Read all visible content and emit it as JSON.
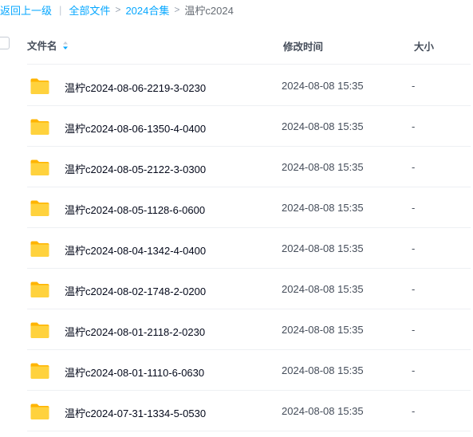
{
  "breadcrumb": {
    "back": "返回上一级",
    "separator": "|",
    "items": [
      "全部文件",
      "2024合集"
    ],
    "current": "温柠c2024"
  },
  "header": {
    "name": "文件名",
    "mtime": "修改时间",
    "size": "大小"
  },
  "colors": {
    "link": "#06a7ff",
    "folder": "#ffc520",
    "sort_active": "#06a7ff"
  },
  "files": [
    {
      "name": "温柠c2024-08-06-2219-3-0230",
      "mtime": "2024-08-08 15:35",
      "size": "-",
      "icon": "folder-icon"
    },
    {
      "name": "温柠c2024-08-06-1350-4-0400",
      "mtime": "2024-08-08 15:35",
      "size": "-",
      "icon": "folder-icon"
    },
    {
      "name": "温柠c2024-08-05-2122-3-0300",
      "mtime": "2024-08-08 15:35",
      "size": "-",
      "icon": "folder-icon"
    },
    {
      "name": "温柠c2024-08-05-1128-6-0600",
      "mtime": "2024-08-08 15:35",
      "size": "-",
      "icon": "folder-icon"
    },
    {
      "name": "温柠c2024-08-04-1342-4-0400",
      "mtime": "2024-08-08 15:35",
      "size": "-",
      "icon": "folder-icon"
    },
    {
      "name": "温柠c2024-08-02-1748-2-0200",
      "mtime": "2024-08-08 15:35",
      "size": "-",
      "icon": "folder-icon"
    },
    {
      "name": "温柠c2024-08-01-2118-2-0230",
      "mtime": "2024-08-08 15:35",
      "size": "-",
      "icon": "folder-icon"
    },
    {
      "name": "温柠c2024-08-01-1110-6-0630",
      "mtime": "2024-08-08 15:35",
      "size": "-",
      "icon": "folder-icon"
    },
    {
      "name": "温柠c2024-07-31-1334-5-0530",
      "mtime": "2024-08-08 15:35",
      "size": "-",
      "icon": "folder-icon"
    }
  ]
}
